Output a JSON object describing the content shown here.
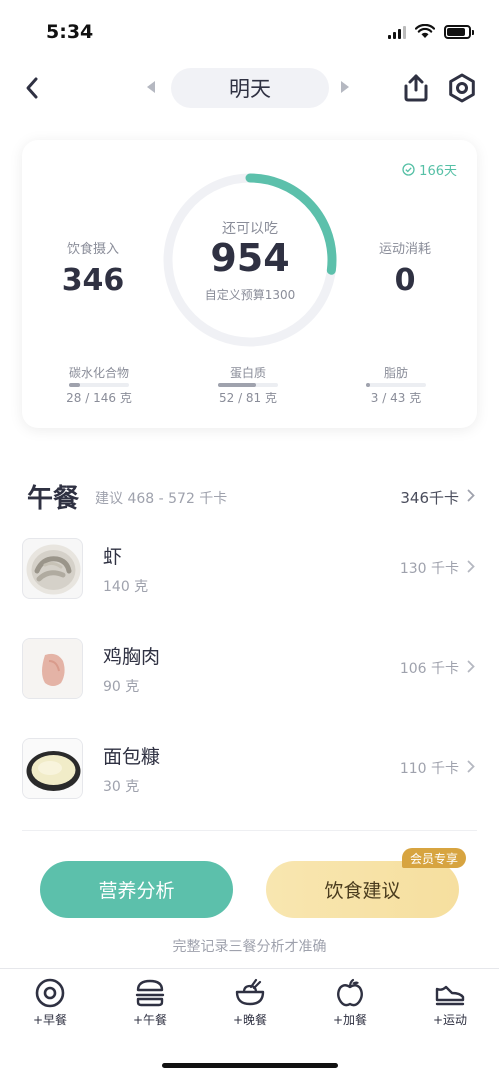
{
  "status": {
    "time": "5:34"
  },
  "nav": {
    "day_label": "明天"
  },
  "summary": {
    "streak": "166天",
    "intake": {
      "label": "饮食摄入",
      "value": "346"
    },
    "remaining": {
      "label": "还可以吃",
      "value": "954",
      "budget_text": "自定义预算1300"
    },
    "burn": {
      "label": "运动消耗",
      "value": "0"
    },
    "macros": [
      {
        "name": "碳水化合物",
        "value_text": "28 / 146 克",
        "fraction": 0.19
      },
      {
        "name": "蛋白质",
        "value_text": "52 / 81 克",
        "fraction": 0.64
      },
      {
        "name": "脂肪",
        "value_text": "3 / 43 克",
        "fraction": 0.07
      }
    ],
    "ring_fraction": 0.27,
    "colors": {
      "accent": "#5cc0ab",
      "ring_track": "#f0f1f5"
    }
  },
  "meal": {
    "title": "午餐",
    "suggest": "建议 468 - 572 千卡",
    "total": "346千卡",
    "foods": [
      {
        "name": "虾",
        "amount": "140 克",
        "kcal": "130 千卡",
        "icon": "shrimp-photo"
      },
      {
        "name": "鸡胸肉",
        "amount": "90 克",
        "kcal": "106 千卡",
        "icon": "chicken-breast-photo"
      },
      {
        "name": "面包糠",
        "amount": "30 克",
        "kcal": "110 千卡",
        "icon": "breadcrumbs-photo"
      }
    ]
  },
  "actions": {
    "analysis": "营养分析",
    "advice": "饮食建议",
    "vip_badge": "会员专享",
    "hint": "完整记录三餐分析才准确"
  },
  "tabs": [
    {
      "label": "+早餐",
      "icon": "egg-icon"
    },
    {
      "label": "+午餐",
      "icon": "burger-icon"
    },
    {
      "label": "+晚餐",
      "icon": "bowl-icon"
    },
    {
      "label": "+加餐",
      "icon": "apple-icon"
    },
    {
      "label": "+运动",
      "icon": "shoe-icon"
    }
  ]
}
